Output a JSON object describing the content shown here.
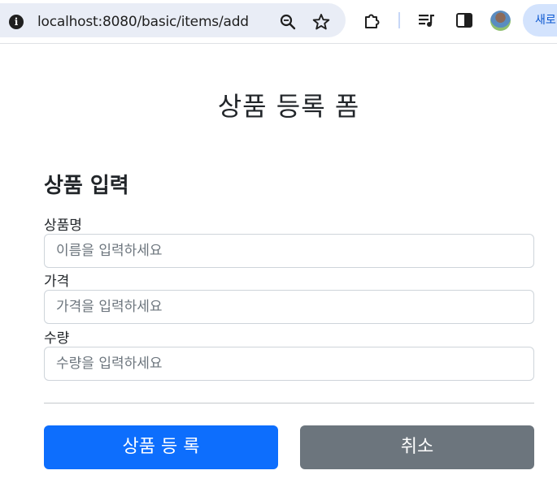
{
  "browser": {
    "url": "localhost:8080/basic/items/add",
    "new_button_label": "새로"
  },
  "page": {
    "title": "상품 등록 폼",
    "section_title": "상품 입력"
  },
  "form": {
    "fields": [
      {
        "label": "상품명",
        "placeholder": "이름을 입력하세요",
        "value": ""
      },
      {
        "label": "가격",
        "placeholder": "가격을 입력하세요",
        "value": ""
      },
      {
        "label": "수량",
        "placeholder": "수량을 입력하세요",
        "value": ""
      }
    ],
    "submit_label": "상품 등 록",
    "cancel_label": "취소"
  },
  "colors": {
    "primary": "#0d6efd",
    "secondary": "#6c757d",
    "omnibox": "#e9edf6"
  },
  "icons": [
    "info-icon",
    "zoom-icon",
    "star-icon",
    "extensions-icon",
    "media-icon",
    "side-panel-icon"
  ]
}
